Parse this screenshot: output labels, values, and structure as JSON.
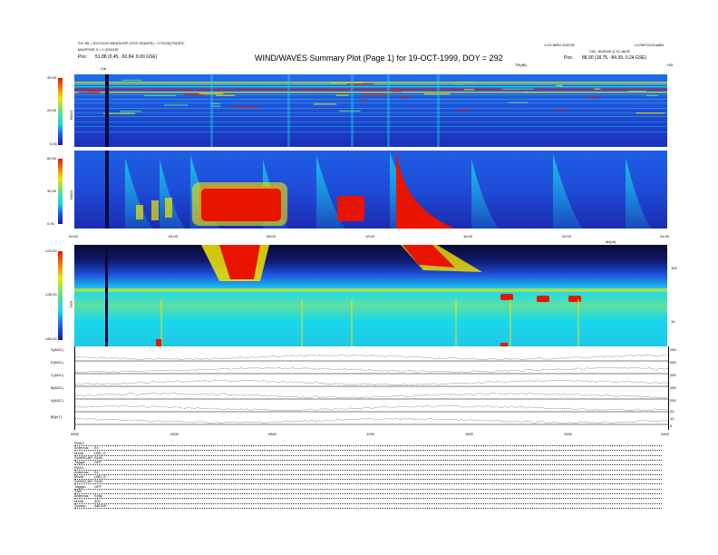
{
  "header": {
    "title": "WIND/WAVES Summary Plot (Page 1) for 19-OCT-1999, DOY = 292",
    "left_line1": "S/C 85 = SCCOOO MEASOSP (TOS SO(NPK) - 0.7SOD(TS)SPC",
    "left_line2": "MAGPHIS 3 = 1.3O/DOE",
    "pos_left_label": "Pos:",
    "pos_left": "51.88 (0.45, -50.84, 8.00 GSE)",
    "right_line1": "1.1O WED 20/FOE",
    "right_line2": "CAL: 80/DOE (1.0) JAOE",
    "right_top": "LCSMTOO3.w581",
    "pos_right_label": "Pos:",
    "pos_right": "88.00 (18.75, -84.39, 0.24 GSE)",
    "cal_marker": "Cal",
    "tr_label": "TR(dB)",
    "tr_right": "Hi3",
    "tnr_units": "db(ch)"
  },
  "colors": {
    "dark_blue": "#1a1aa8",
    "blue": "#1f55e0",
    "cyan": "#18d8ec",
    "green": "#5ee08a",
    "yellow": "#f2e600",
    "red": "#e81400"
  },
  "chart_data": [
    {
      "type": "heatmap",
      "name": "RAD2 dynamic spectrum",
      "ylabel": "RAD2",
      "yticks": [
        "40.00",
        "20.00",
        "0.00"
      ],
      "ylim": [
        0,
        40
      ],
      "xlim": [
        0,
        24
      ]
    },
    {
      "type": "heatmap",
      "name": "RAD1 dynamic spectrum",
      "ylabel": "RAD1",
      "yticks": [
        "60.00",
        "30.00",
        "0.00"
      ],
      "ylim": [
        0,
        60
      ],
      "xticks": [
        "00:00",
        "04:00",
        "08:00",
        "12:00",
        "16:00",
        "20:00",
        "24:00"
      ],
      "xlim": [
        0,
        24
      ]
    },
    {
      "type": "heatmap",
      "name": "TNR dynamic spectrum",
      "ylabel": "TNR",
      "yticks": [
        "-120.00",
        "-135.00",
        "-150.00"
      ],
      "ylim": [
        -150,
        -120
      ],
      "right_ticks": [
        "100",
        "10"
      ],
      "xlim": [
        0,
        24
      ]
    },
    {
      "type": "line",
      "name": "Sensor traces",
      "series": [
        {
          "name": "S(ADC)",
          "right_tick": "250"
        },
        {
          "name": "E(ADC)",
          "right_tick": "250"
        },
        {
          "name": "C(ADC)",
          "right_tick": "250"
        },
        {
          "name": "B(ADC)",
          "right_tick": "250"
        },
        {
          "name": "A(ADC)",
          "right_tick": "250"
        },
        {
          "name": "|B|(nT)",
          "right_ticks": [
            "20",
            "10",
            "0"
          ]
        }
      ],
      "xticks": [
        "0000",
        "0400",
        "0800",
        "1200",
        "1600",
        "2000",
        "2400"
      ],
      "xlim": [
        0,
        24
      ]
    }
  ],
  "params": [
    {
      "label": "RAD2",
      "value": ""
    },
    {
      "label": "Antenna:",
      "value": "Ex"
    },
    {
      "label": "Mode:",
      "value": "LBD_S"
    },
    {
      "label": "SUMSCAP:",
      "value": "SUM"
    },
    {
      "label": "Toggle:",
      "value": "OFF"
    },
    {
      "label": "RAD1",
      "value": ""
    },
    {
      "label": "Antenna:",
      "value": "Ex"
    },
    {
      "label": "Mode:",
      "value": "LBD_S"
    },
    {
      "label": "SUMSCAP:",
      "value": "SUM"
    },
    {
      "label": "Toggle:",
      "value": "OFF"
    },
    {
      "label": "TNR",
      "value": ""
    },
    {
      "label": "Antenna:",
      "value": "Exfly"
    },
    {
      "label": "Mode:",
      "value": "A/D"
    },
    {
      "label": "Scomp:",
      "value": "ABCDE"
    }
  ]
}
